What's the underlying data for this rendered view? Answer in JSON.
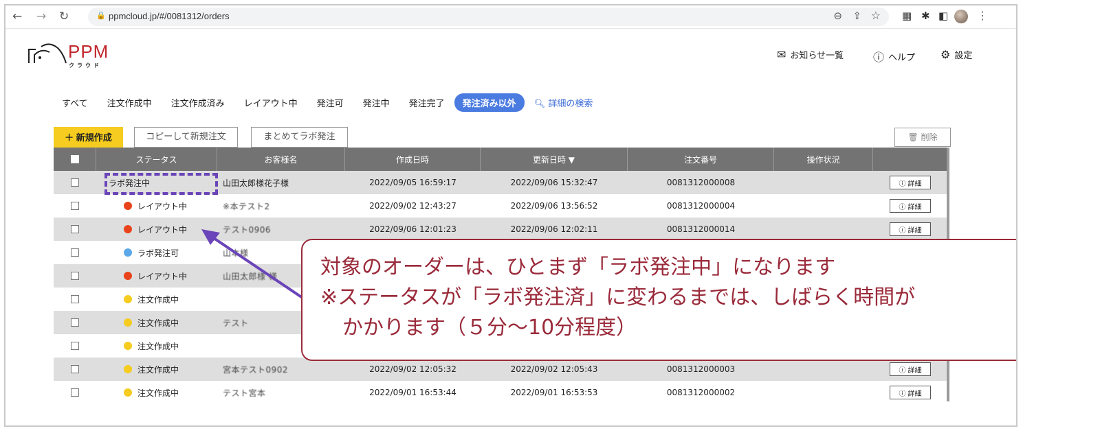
{
  "browser": {
    "url": "ppmcloud.jp/#/0081312/orders",
    "icons": [
      "back-icon",
      "forward-icon",
      "reload-icon",
      "lock-icon",
      "zoom-icon",
      "share-icon",
      "star-icon",
      "extension-icon",
      "puzzle-icon",
      "sidebar-icon",
      "avatar",
      "kebab-menu-icon"
    ]
  },
  "header": {
    "brand": "PPM",
    "brand_sub": "クラウド",
    "notifications": "お知らせ一覧",
    "help": "ヘルプ",
    "settings": "設定"
  },
  "tabs": [
    {
      "label": "すべて"
    },
    {
      "label": "注文作成中"
    },
    {
      "label": "注文作成済み"
    },
    {
      "label": "レイアウト中"
    },
    {
      "label": "発注可"
    },
    {
      "label": "発注中"
    },
    {
      "label": "発注完了"
    },
    {
      "label": "発注済み以外",
      "active": true
    },
    {
      "label": "詳細の検索"
    }
  ],
  "actions": {
    "new": "新規作成",
    "copy_new": "コピーして新規注文",
    "bulk_lab": "まとめてラボ発注",
    "delete": "削除"
  },
  "table": {
    "headers": [
      "ステータス",
      "お客様名",
      "作成日時",
      "更新日時 ▼",
      "注文番号",
      "操作状況"
    ],
    "detail_label": "詳細",
    "rows": [
      {
        "status": "ラボ発注中",
        "color": "",
        "customer": "山田太郎様花子様",
        "created": "2022/09/05 16:59:17",
        "updated": "2022/09/06 15:32:47",
        "order": "0081312000008",
        "ops": "",
        "detail": true
      },
      {
        "status": "レイアウト中",
        "color": "#e8431a",
        "customer": "※本テスト2",
        "created": "2022/09/02 12:43:27",
        "updated": "2022/09/06 13:56:52",
        "order": "0081312000004",
        "ops": "",
        "detail": true
      },
      {
        "status": "レイアウト中",
        "color": "#e8431a",
        "customer": "テスト0906",
        "created": "2022/09/06 12:01:23",
        "updated": "2022/09/06 12:02:11",
        "order": "0081312000014",
        "ops": "",
        "detail": true
      },
      {
        "status": "ラボ発注可",
        "color": "#5aa8e8",
        "customer": "山本様",
        "created": "",
        "updated": "",
        "order": "",
        "ops": "",
        "detail": false
      },
      {
        "status": "レイアウト中",
        "color": "#e8431a",
        "customer": "山田太郎様 様",
        "created": "",
        "updated": "",
        "order": "",
        "ops": "",
        "detail": false
      },
      {
        "status": "注文作成中",
        "color": "#f5cc1f",
        "customer": "",
        "created": "",
        "updated": "",
        "order": "",
        "ops": "",
        "detail": false
      },
      {
        "status": "注文作成中",
        "color": "#f5cc1f",
        "customer": "テスト",
        "created": "",
        "updated": "",
        "order": "",
        "ops": "",
        "detail": false
      },
      {
        "status": "注文作成中",
        "color": "#f5cc1f",
        "customer": "",
        "created": "",
        "updated": "",
        "order": "",
        "ops": "",
        "detail": false
      },
      {
        "status": "注文作成中",
        "color": "#f5cc1f",
        "customer": "宮本テスト0902",
        "created": "2022/09/02 12:05:32",
        "updated": "2022/09/02 12:05:43",
        "order": "0081312000003",
        "ops": "",
        "detail": true
      },
      {
        "status": "注文作成中",
        "color": "#f5cc1f",
        "customer": "テスト宮本",
        "created": "2022/09/01 16:53:44",
        "updated": "2022/09/01 16:53:53",
        "order": "0081312000002",
        "ops": "",
        "detail": true
      }
    ]
  },
  "callout": {
    "line1": "対象のオーダーは、ひとまず「ラボ発注中」になります",
    "line2": "※ステータスが「ラボ発注済」に変わるまでは、しばらく時間が",
    "line3": "かかります（５分～10分程度）"
  },
  "colors": {
    "accent": "#4a7be0",
    "new_button": "#f5cc1f",
    "annotation_purple": "#6a44b8",
    "annotation_text": "#9a2a3a",
    "status_layout": "#e8431a",
    "status_lab_ok": "#5aa8e8",
    "status_creating": "#f5cc1f"
  }
}
